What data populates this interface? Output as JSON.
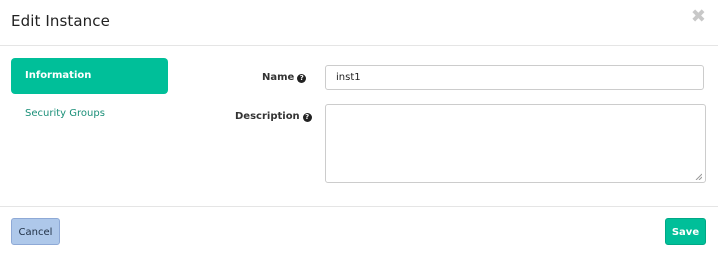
{
  "modal": {
    "title": "Edit Instance",
    "close_symbol": "✖"
  },
  "tabs": [
    {
      "label": "Information",
      "active": true
    },
    {
      "label": "Security Groups",
      "active": false
    }
  ],
  "form": {
    "name_label": "Name",
    "name_value": "inst1",
    "description_label": "Description",
    "description_value": "",
    "help_symbol": "?"
  },
  "footer": {
    "cancel_label": "Cancel",
    "save_label": "Save"
  },
  "colors": {
    "accent": "#00bf99",
    "cancel_button": "#aec8ea"
  }
}
